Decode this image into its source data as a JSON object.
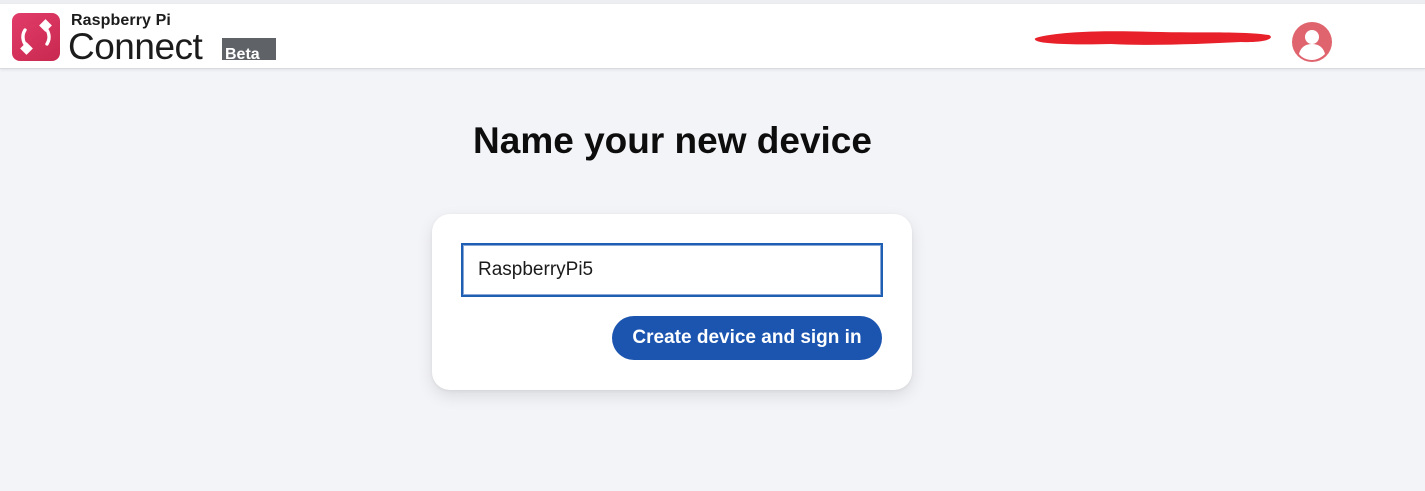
{
  "header": {
    "brand_top": "Raspberry Pi",
    "brand_name": "Connect",
    "badge": "Beta",
    "logo_icon": "connect-logo-icon",
    "avatar_icon": "user-avatar-icon",
    "redacted_email": true
  },
  "main": {
    "title": "Name your new device",
    "device_name_value": "RaspberryPi5",
    "submit_label": "Create device and sign in"
  },
  "colors": {
    "background": "#f3f4f8",
    "brand_red": "#d33658",
    "button_blue": "#1c55b0",
    "input_border": "#1f5fb3",
    "redaction": "#e8202a"
  }
}
